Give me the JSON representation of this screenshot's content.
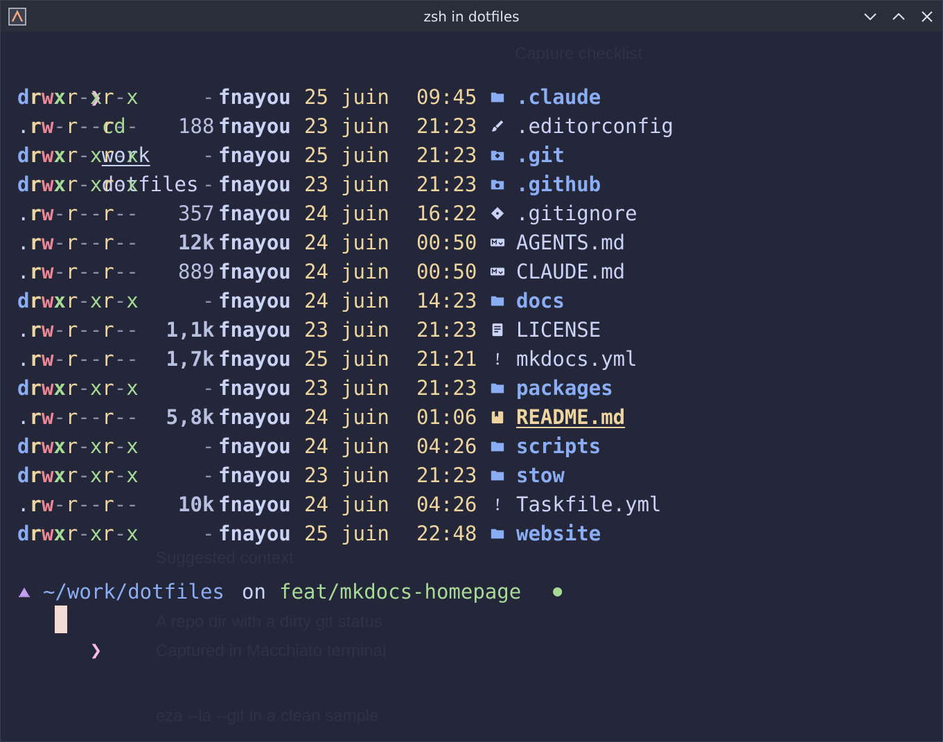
{
  "window": {
    "title": "zsh in dotfiles"
  },
  "command": {
    "prompt_symbol": "❯",
    "cmd": "cd",
    "arg1": "work",
    "arg2": "dotfiles"
  },
  "listing": [
    {
      "perm_type": "d",
      "perm": "rwxr-xr-x",
      "size": "-",
      "user": "fnayou",
      "day": "25",
      "month": "juin",
      "time": "09:45",
      "icon": "folder-icon",
      "name": ".claude",
      "kind": "dir"
    },
    {
      "perm_type": ".",
      "perm": "rw-r--r--",
      "size": "188",
      "user": "fnayou",
      "day": "23",
      "month": "juin",
      "time": "21:23",
      "icon": "brush-icon",
      "name": ".editorconfig",
      "kind": "file"
    },
    {
      "perm_type": "d",
      "perm": "rwxr-xr-x",
      "size": "-",
      "user": "fnayou",
      "day": "25",
      "month": "juin",
      "time": "21:23",
      "icon": "git-folder-icon",
      "name": ".git",
      "kind": "dir"
    },
    {
      "perm_type": "d",
      "perm": "rwxr-xr-x",
      "size": "-",
      "user": "fnayou",
      "day": "23",
      "month": "juin",
      "time": "21:23",
      "icon": "github-folder-icon",
      "name": ".github",
      "kind": "dir"
    },
    {
      "perm_type": ".",
      "perm": "rw-r--r--",
      "size": "357",
      "user": "fnayou",
      "day": "24",
      "month": "juin",
      "time": "16:22",
      "icon": "git-diamond-icon",
      "name": ".gitignore",
      "kind": "file"
    },
    {
      "perm_type": ".",
      "perm": "rw-r--r--",
      "size": "12k",
      "user": "fnayou",
      "day": "24",
      "month": "juin",
      "time": "00:50",
      "icon": "markdown-icon",
      "name": "AGENTS.md",
      "kind": "file"
    },
    {
      "perm_type": ".",
      "perm": "rw-r--r--",
      "size": "889",
      "user": "fnayou",
      "day": "24",
      "month": "juin",
      "time": "00:50",
      "icon": "markdown-icon",
      "name": "CLAUDE.md",
      "kind": "file"
    },
    {
      "perm_type": "d",
      "perm": "rwxr-xr-x",
      "size": "-",
      "user": "fnayou",
      "day": "24",
      "month": "juin",
      "time": "14:23",
      "icon": "folder-icon",
      "name": "docs",
      "kind": "dir"
    },
    {
      "perm_type": ".",
      "perm": "rw-r--r--",
      "size": "1,1k",
      "user": "fnayou",
      "day": "23",
      "month": "juin",
      "time": "21:23",
      "icon": "license-icon",
      "name": "LICENSE",
      "kind": "file"
    },
    {
      "perm_type": ".",
      "perm": "rw-r--r--",
      "size": "1,7k",
      "user": "fnayou",
      "day": "25",
      "month": "juin",
      "time": "21:21",
      "icon": "yaml-icon",
      "name": "mkdocs.yml",
      "kind": "file"
    },
    {
      "perm_type": "d",
      "perm": "rwxr-xr-x",
      "size": "-",
      "user": "fnayou",
      "day": "23",
      "month": "juin",
      "time": "21:23",
      "icon": "folder-icon",
      "name": "packages",
      "kind": "dir"
    },
    {
      "perm_type": ".",
      "perm": "rw-r--r--",
      "size": "5,8k",
      "user": "fnayou",
      "day": "24",
      "month": "juin",
      "time": "01:06",
      "icon": "readme-icon",
      "name": "README.md",
      "kind": "readme"
    },
    {
      "perm_type": "d",
      "perm": "rwxr-xr-x",
      "size": "-",
      "user": "fnayou",
      "day": "24",
      "month": "juin",
      "time": "04:26",
      "icon": "folder-icon",
      "name": "scripts",
      "kind": "dir"
    },
    {
      "perm_type": "d",
      "perm": "rwxr-xr-x",
      "size": "-",
      "user": "fnayou",
      "day": "23",
      "month": "juin",
      "time": "21:23",
      "icon": "folder-icon",
      "name": "stow",
      "kind": "dir"
    },
    {
      "perm_type": ".",
      "perm": "rw-r--r--",
      "size": "10k",
      "user": "fnayou",
      "day": "24",
      "month": "juin",
      "time": "04:26",
      "icon": "yaml-icon",
      "name": "Taskfile.yml",
      "kind": "file"
    },
    {
      "perm_type": "d",
      "perm": "rwxr-xr-x",
      "size": "-",
      "user": "fnayou",
      "day": "25",
      "month": "juin",
      "time": "22:48",
      "icon": "folder-icon",
      "name": "website",
      "kind": "dir"
    }
  ],
  "status": {
    "path": "~/work/dotfiles",
    "on": "on",
    "branch_symbol": "",
    "branch": "feat/mkdocs-homepage",
    "dirty": "●"
  },
  "prompt": {
    "symbol": "❯"
  },
  "background_ghost": {
    "t1": "Capture checklist",
    "t2": "Suggested context",
    "t3": "A repo dir with a dirty git status",
    "t4": "Captured in Macchiato terminal",
    "t5": "eza --la --git in a clean sample"
  },
  "colors": {
    "background": "#24273a",
    "titlebar": "#2a2d3a",
    "blue": "#8aadf4",
    "yellow": "#eed49f",
    "red": "#ed8796",
    "green": "#a6da95",
    "pink": "#f5bde6",
    "text": "#cad3f5"
  }
}
